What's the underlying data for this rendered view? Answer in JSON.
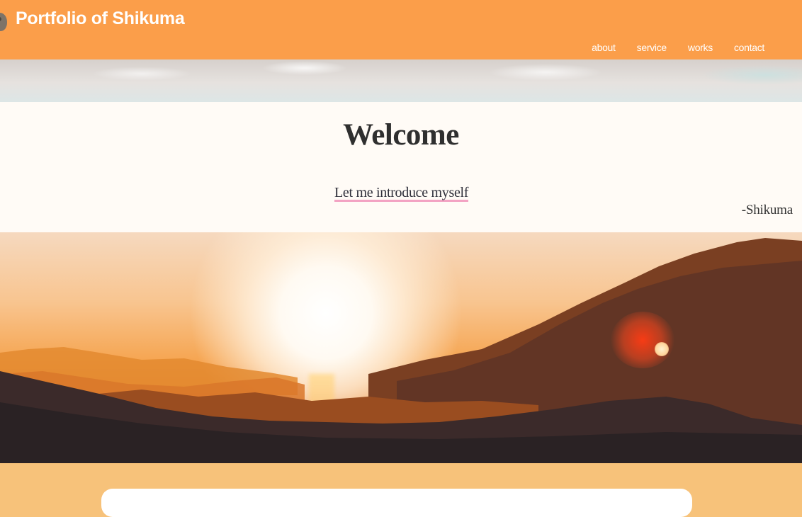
{
  "header": {
    "site_title": "Portfolio of Shikuma",
    "logo_icon": "bear-icon",
    "background": "#fb9e4a",
    "nav": [
      {
        "label": "about"
      },
      {
        "label": "service"
      },
      {
        "label": "works"
      },
      {
        "label": "contact"
      }
    ]
  },
  "hero": {
    "title": "Welcome",
    "intro_link": "Let me introduce myself",
    "signature": "-Shikuma",
    "link_underline_color": "#f3a3c3"
  },
  "bottom": {
    "background": "#f7c27a"
  }
}
